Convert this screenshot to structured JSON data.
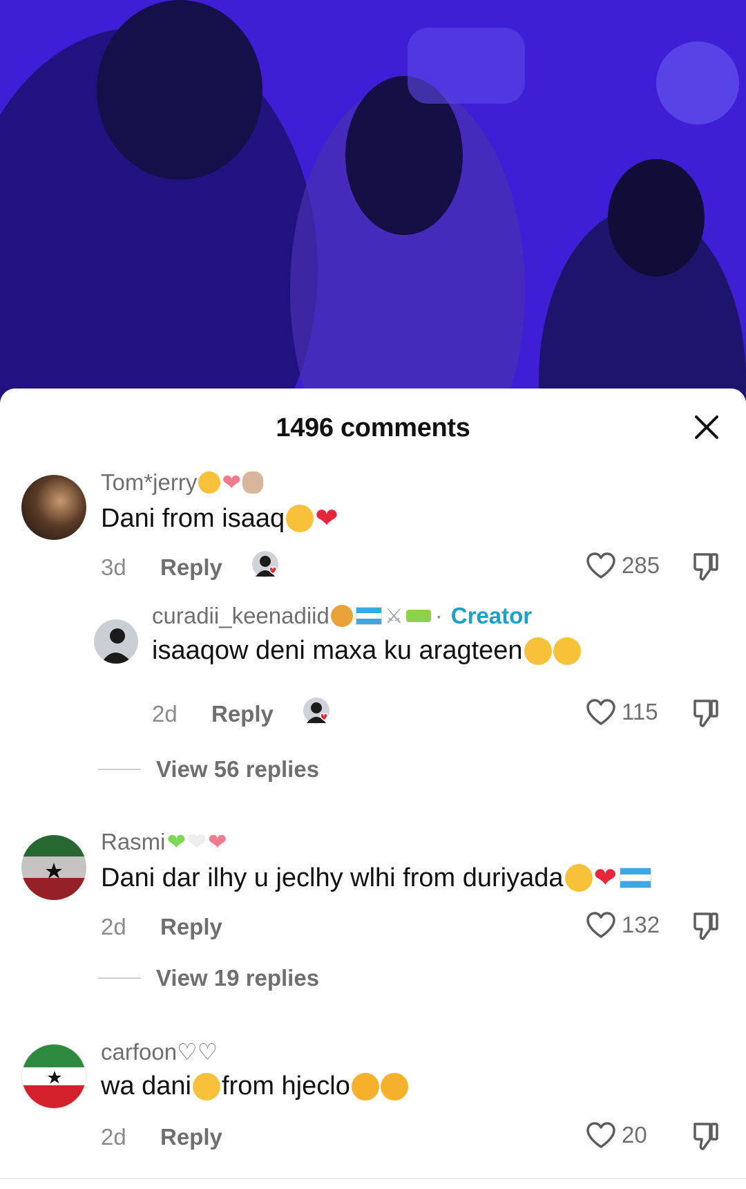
{
  "sheet": {
    "title": "1496 comments"
  },
  "comments": [
    {
      "username": "Tom*jerry",
      "text": "Dani from isaaq",
      "age": "3d",
      "reply_label": "Reply",
      "likes": "285"
    },
    {
      "username": "curadii_keenadiid",
      "creator_label": "Creator",
      "separator": "·",
      "text": "isaaqow deni maxa ku aragteen",
      "age": "2d",
      "reply_label": "Reply",
      "likes": "115"
    },
    {
      "username": "Rasmi",
      "text": "Dani dar ilhy u jeclhy wlhi from duriyada",
      "age": "2d",
      "reply_label": "Reply",
      "likes": "132"
    },
    {
      "username": "carfoon♡♡",
      "text_part1": "wa dani",
      "text_part2": "from hjeclo",
      "age": "2d",
      "reply_label": "Reply",
      "likes": "20"
    }
  ],
  "view_replies": [
    "View 56 replies",
    "View 19 replies"
  ],
  "colors": {
    "video_bg": "#3e1fd6",
    "creator": "#1aa1c8",
    "heart_red": "#e8253b"
  }
}
